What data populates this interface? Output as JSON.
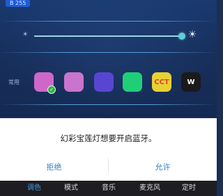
{
  "status_badge": "B 255",
  "brightness": {
    "value_fraction": 1.0,
    "min_icon": "sun-small-icon",
    "max_icon": "sun-large-icon"
  },
  "color_row": {
    "label": "常用",
    "swatches": [
      {
        "color": "#cf67c9",
        "text": "",
        "selected": true
      },
      {
        "color": "#c974cd",
        "text": "",
        "selected": false
      },
      {
        "color": "#5846d2",
        "text": "",
        "selected": false
      },
      {
        "color": "#1fcf78",
        "text": "",
        "selected": false
      },
      {
        "color": "#e8d133",
        "text": "CCT",
        "text_color": "#e0432f",
        "selected": false
      },
      {
        "color": "#1a1a1a",
        "text": "W",
        "text_color": "#ffffff",
        "selected": false
      }
    ]
  },
  "dialog": {
    "message": "幻彩宝莲灯想要开启蓝牙。",
    "deny_label": "拒绝",
    "allow_label": "允许"
  },
  "bottom_nav": {
    "items": [
      {
        "label": "调色",
        "active": true
      },
      {
        "label": "模式",
        "active": false
      },
      {
        "label": "音乐",
        "active": false
      },
      {
        "label": "麦克风",
        "active": false
      },
      {
        "label": "定时",
        "active": false
      }
    ]
  },
  "colors": {
    "accent": "#2f7fc0",
    "nav_active": "#3f9ae2",
    "check": "#35b04a"
  }
}
